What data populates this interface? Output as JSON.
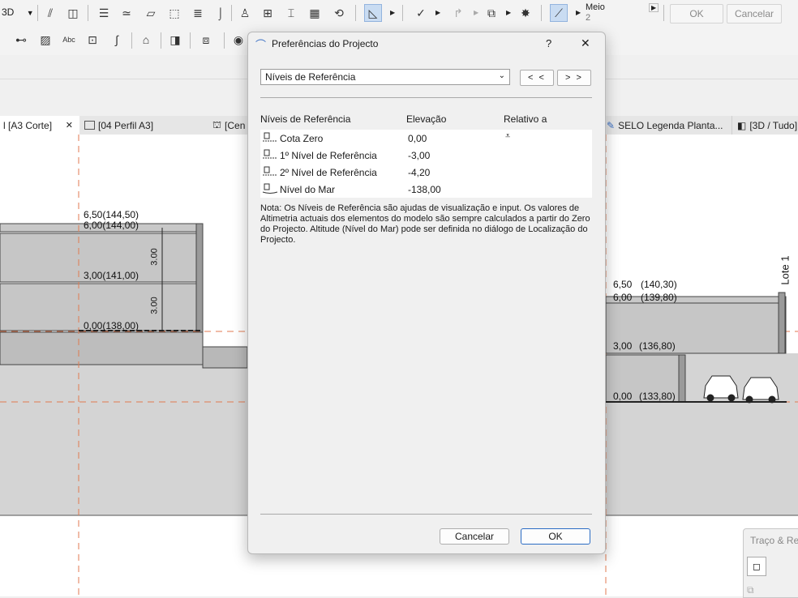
{
  "toolbar": {
    "view_mode": "3D",
    "mode_label": "Meio",
    "mode_value": "2",
    "ok_label": "OK",
    "cancel_label": "Cancelar"
  },
  "tabs": [
    {
      "label": "l [A3 Corte]"
    },
    {
      "label": "[04 Perfil A3]"
    },
    {
      "label": "[Cen"
    },
    {
      "label": "SELO Legenda Planta..."
    },
    {
      "label": "[3D / Tudo]"
    }
  ],
  "drawing": {
    "left_labels": [
      "6,50(144,50)",
      "6,00(144,00)",
      "3,00(141,00)",
      "0,00(138,00)"
    ],
    "dims": [
      "3.00",
      "3.00"
    ],
    "right_labels": [
      "6,50",
      "(140,30)",
      "6,00",
      "(139,80)",
      "3,00",
      "(136,80)",
      "0,00",
      "(133,80)"
    ],
    "lote": "Lote 1"
  },
  "panel": {
    "title": "Traço & Ret"
  },
  "dialog": {
    "title": "Preferências do Projecto",
    "help": "?",
    "close": "✕",
    "select_value": "Níveis de Referência",
    "prev_label": "< <",
    "next_label": "> >",
    "columns": [
      "Níveis de Referência",
      "Elevação",
      "Relativo a"
    ],
    "rows": [
      {
        "name": "Cota Zero",
        "elevation": "0,00"
      },
      {
        "name": "1º Nível de Referência",
        "elevation": "-3,00"
      },
      {
        "name": "2º Nível de Referência",
        "elevation": "-4,20"
      },
      {
        "name": "Nível do Mar",
        "elevation": "-138,00"
      }
    ],
    "note": "Nota: Os Níveis de Referência são ajudas de visualização e input. Os valores de Altimetria actuais dos elementos do modelo são sempre calculados a partir do Zero do Projecto. Altitude (Nível do Mar) pode ser definida no diálogo de Localização do Projecto.",
    "cancel_label": "Cancelar",
    "ok_label": "OK"
  }
}
